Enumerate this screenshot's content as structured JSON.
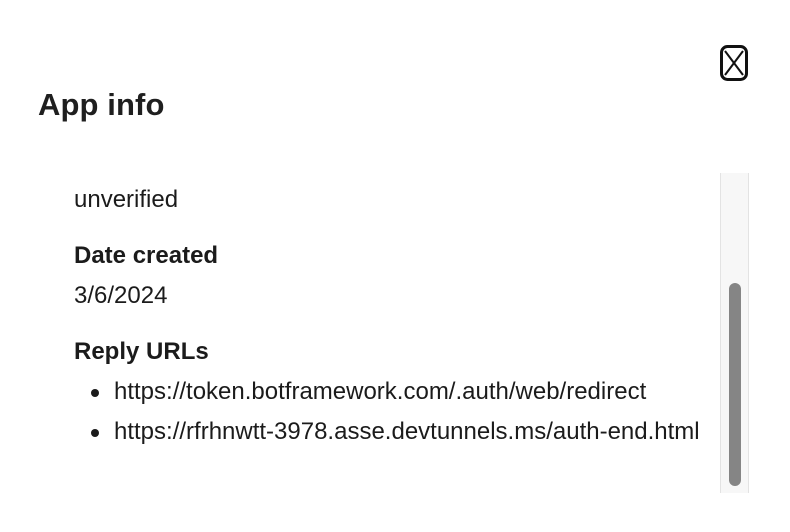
{
  "dialog": {
    "title": "App info",
    "close_icon": "close-icon"
  },
  "details": {
    "verification_value": "unverified",
    "date_created_label": "Date created",
    "date_created_value": "3/6/2024",
    "reply_urls_label": "Reply URLs",
    "reply_urls": [
      "https://token.botframework.com/.auth/web/redirect",
      "https://rfrhnwtt-3978.asse.devtunnels.ms/auth-end.html"
    ]
  },
  "scrollbar": {
    "position_fraction": 0.55
  }
}
